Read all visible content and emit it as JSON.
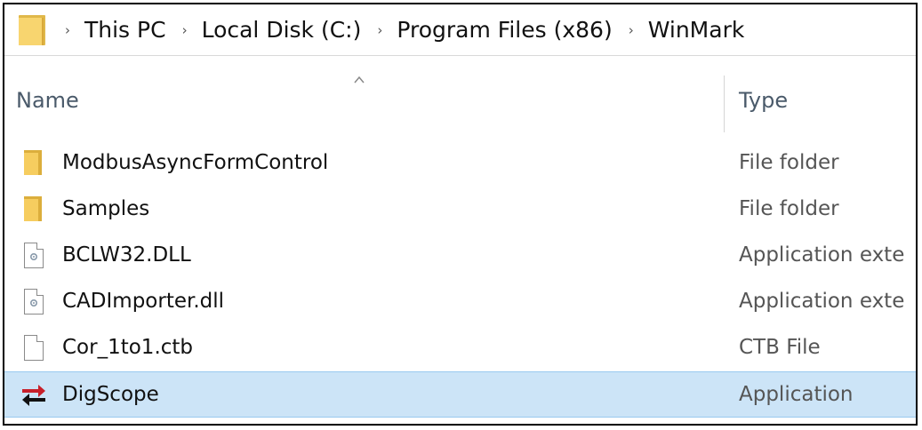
{
  "address_bar": {
    "crumbs": [
      "This PC",
      "Local Disk (C:)",
      "Program Files (x86)",
      "WinMark"
    ],
    "separator": "›"
  },
  "columns": {
    "name": "Name",
    "type": "Type"
  },
  "files": [
    {
      "name": "ModbusAsyncFormControl",
      "type": "File folder",
      "icon": "folder-icon"
    },
    {
      "name": "Samples",
      "type": "File folder",
      "icon": "folder-icon"
    },
    {
      "name": "BCLW32.DLL",
      "type": "Application exte",
      "icon": "dll-file-icon"
    },
    {
      "name": "CADImporter.dll",
      "type": "Application exte",
      "icon": "dll-file-icon"
    },
    {
      "name": "Cor_1to1.ctb",
      "type": "CTB File",
      "icon": "generic-file-icon"
    },
    {
      "name": "DigScope",
      "type": "Application",
      "icon": "digscope-app-icon",
      "selected": true
    }
  ],
  "colors": {
    "selection_bg": "#cce4f7",
    "selection_border": "#99c9ef",
    "folder_yellow": "#f6cd5f",
    "app_icon_red": "#c8202a"
  }
}
